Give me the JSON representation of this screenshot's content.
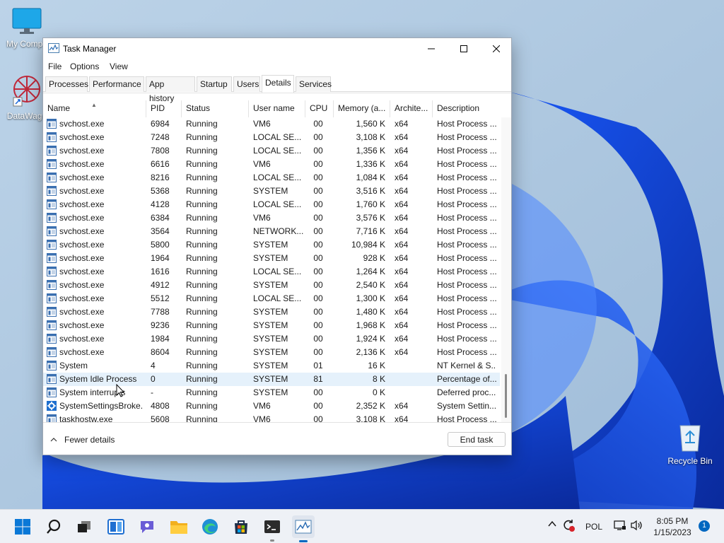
{
  "desktop": {
    "icons": [
      {
        "label": "My Compu",
        "icon": "computer-icon"
      },
      {
        "label": "DataWago",
        "icon": "datawagon-icon"
      },
      {
        "label": "Recycle Bin",
        "icon": "recycle-bin-icon"
      }
    ]
  },
  "window": {
    "title": "Task Manager",
    "controls": {
      "minimize": "minimize-icon",
      "maximize": "maximize-icon",
      "close": "close-icon"
    },
    "menu": [
      "File",
      "Options",
      "View"
    ],
    "tabs": [
      "Processes",
      "Performance",
      "App history",
      "Startup",
      "Users",
      "Details",
      "Services"
    ],
    "active_tab": "Details",
    "columns": [
      "Name",
      "PID",
      "Status",
      "User name",
      "CPU",
      "Memory (a...",
      "Archite...",
      "Description"
    ],
    "rows": [
      {
        "name": "svchost.exe",
        "pid": "6984",
        "status": "Running",
        "user": "VM6",
        "cpu": "00",
        "mem": "1,560 K",
        "arch": "x64",
        "desc": "Host Process ...",
        "icon": "svchost"
      },
      {
        "name": "svchost.exe",
        "pid": "7248",
        "status": "Running",
        "user": "LOCAL SE...",
        "cpu": "00",
        "mem": "3,108 K",
        "arch": "x64",
        "desc": "Host Process ...",
        "icon": "svchost"
      },
      {
        "name": "svchost.exe",
        "pid": "7808",
        "status": "Running",
        "user": "LOCAL SE...",
        "cpu": "00",
        "mem": "1,356 K",
        "arch": "x64",
        "desc": "Host Process ...",
        "icon": "svchost"
      },
      {
        "name": "svchost.exe",
        "pid": "6616",
        "status": "Running",
        "user": "VM6",
        "cpu": "00",
        "mem": "1,336 K",
        "arch": "x64",
        "desc": "Host Process ...",
        "icon": "svchost"
      },
      {
        "name": "svchost.exe",
        "pid": "8216",
        "status": "Running",
        "user": "LOCAL SE...",
        "cpu": "00",
        "mem": "1,084 K",
        "arch": "x64",
        "desc": "Host Process ...",
        "icon": "svchost"
      },
      {
        "name": "svchost.exe",
        "pid": "5368",
        "status": "Running",
        "user": "SYSTEM",
        "cpu": "00",
        "mem": "3,516 K",
        "arch": "x64",
        "desc": "Host Process ...",
        "icon": "svchost"
      },
      {
        "name": "svchost.exe",
        "pid": "4128",
        "status": "Running",
        "user": "LOCAL SE...",
        "cpu": "00",
        "mem": "1,760 K",
        "arch": "x64",
        "desc": "Host Process ...",
        "icon": "svchost"
      },
      {
        "name": "svchost.exe",
        "pid": "6384",
        "status": "Running",
        "user": "VM6",
        "cpu": "00",
        "mem": "3,576 K",
        "arch": "x64",
        "desc": "Host Process ...",
        "icon": "svchost"
      },
      {
        "name": "svchost.exe",
        "pid": "3564",
        "status": "Running",
        "user": "NETWORK...",
        "cpu": "00",
        "mem": "7,716 K",
        "arch": "x64",
        "desc": "Host Process ...",
        "icon": "svchost"
      },
      {
        "name": "svchost.exe",
        "pid": "5800",
        "status": "Running",
        "user": "SYSTEM",
        "cpu": "00",
        "mem": "10,984 K",
        "arch": "x64",
        "desc": "Host Process ...",
        "icon": "svchost"
      },
      {
        "name": "svchost.exe",
        "pid": "1964",
        "status": "Running",
        "user": "SYSTEM",
        "cpu": "00",
        "mem": "928 K",
        "arch": "x64",
        "desc": "Host Process ...",
        "icon": "svchost"
      },
      {
        "name": "svchost.exe",
        "pid": "1616",
        "status": "Running",
        "user": "LOCAL SE...",
        "cpu": "00",
        "mem": "1,264 K",
        "arch": "x64",
        "desc": "Host Process ...",
        "icon": "svchost"
      },
      {
        "name": "svchost.exe",
        "pid": "4912",
        "status": "Running",
        "user": "SYSTEM",
        "cpu": "00",
        "mem": "2,540 K",
        "arch": "x64",
        "desc": "Host Process ...",
        "icon": "svchost"
      },
      {
        "name": "svchost.exe",
        "pid": "5512",
        "status": "Running",
        "user": "LOCAL SE...",
        "cpu": "00",
        "mem": "1,300 K",
        "arch": "x64",
        "desc": "Host Process ...",
        "icon": "svchost"
      },
      {
        "name": "svchost.exe",
        "pid": "7788",
        "status": "Running",
        "user": "SYSTEM",
        "cpu": "00",
        "mem": "1,480 K",
        "arch": "x64",
        "desc": "Host Process ...",
        "icon": "svchost"
      },
      {
        "name": "svchost.exe",
        "pid": "9236",
        "status": "Running",
        "user": "SYSTEM",
        "cpu": "00",
        "mem": "1,968 K",
        "arch": "x64",
        "desc": "Host Process ...",
        "icon": "svchost"
      },
      {
        "name": "svchost.exe",
        "pid": "1984",
        "status": "Running",
        "user": "SYSTEM",
        "cpu": "00",
        "mem": "1,924 K",
        "arch": "x64",
        "desc": "Host Process ...",
        "icon": "svchost"
      },
      {
        "name": "svchost.exe",
        "pid": "8604",
        "status": "Running",
        "user": "SYSTEM",
        "cpu": "00",
        "mem": "2,136 K",
        "arch": "x64",
        "desc": "Host Process ...",
        "icon": "svchost"
      },
      {
        "name": "System",
        "pid": "4",
        "status": "Running",
        "user": "SYSTEM",
        "cpu": "01",
        "mem": "16 K",
        "arch": "",
        "desc": "NT Kernel & S...",
        "icon": "svchost"
      },
      {
        "name": "System Idle Process",
        "pid": "0",
        "status": "Running",
        "user": "SYSTEM",
        "cpu": "81",
        "mem": "8 K",
        "arch": "",
        "desc": "Percentage of...",
        "icon": "svchost",
        "selected": true
      },
      {
        "name": "System interrupts",
        "pid": "-",
        "status": "Running",
        "user": "SYSTEM",
        "cpu": "00",
        "mem": "0 K",
        "arch": "",
        "desc": "Deferred proc...",
        "icon": "svchost"
      },
      {
        "name": "SystemSettingsBroke...",
        "pid": "4808",
        "status": "Running",
        "user": "VM6",
        "cpu": "00",
        "mem": "2,352 K",
        "arch": "x64",
        "desc": "System Settin...",
        "icon": "gear"
      },
      {
        "name": "taskhostw.exe",
        "pid": "5608",
        "status": "Running",
        "user": "VM6",
        "cpu": "00",
        "mem": "3,108 K",
        "arch": "x64",
        "desc": "Host Process ...",
        "icon": "svchost"
      }
    ],
    "footer": {
      "fewer_details": "Fewer details",
      "end_task": "End task"
    }
  },
  "taskbar": {
    "apps": [
      "start-icon",
      "search-icon",
      "task-view-icon",
      "widgets-icon",
      "chat-icon",
      "file-explorer-icon",
      "edge-icon",
      "store-icon",
      "terminal-icon",
      "task-manager-icon"
    ],
    "tray": {
      "language": "POL",
      "time": "8:05 PM",
      "date": "1/15/2023",
      "notifications": "1"
    }
  },
  "colors": {
    "accent": "#0067c0",
    "selection": "#e5f1fb",
    "wallpaper_blue": "#0b3cc4"
  }
}
